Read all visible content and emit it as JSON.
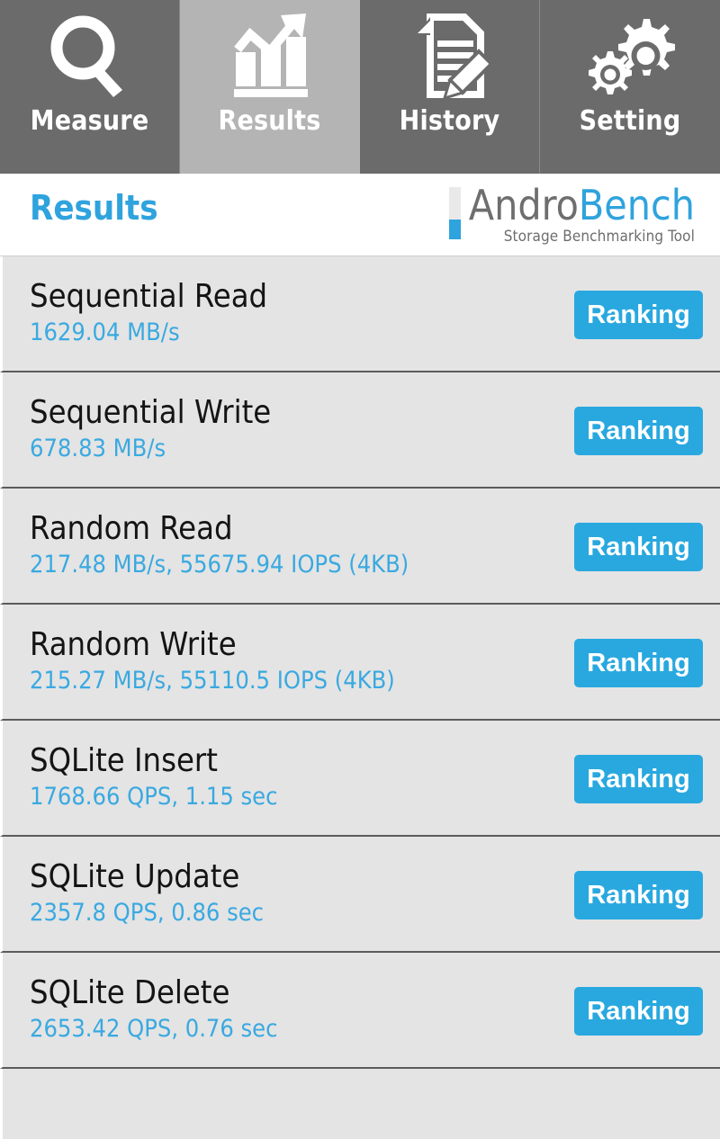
{
  "tabs": [
    {
      "label": "Measure",
      "icon": "magnifier-icon",
      "active": false
    },
    {
      "label": "Results",
      "icon": "bar-chart-trend-icon",
      "active": true
    },
    {
      "label": "History",
      "icon": "document-pencil-icon",
      "active": false
    },
    {
      "label": "Setting",
      "icon": "gears-icon",
      "active": false
    }
  ],
  "header": {
    "title": "Results",
    "logo": {
      "name_part1": "Andro",
      "name_part2": "Bench",
      "tagline": "Storage Benchmarking Tool"
    }
  },
  "results": {
    "button_label": "Ranking",
    "rows": [
      {
        "title": "Sequential Read",
        "value": "1629.04 MB/s"
      },
      {
        "title": "Sequential Write",
        "value": "678.83 MB/s"
      },
      {
        "title": "Random Read",
        "value": "217.48 MB/s, 55675.94 IOPS (4KB)"
      },
      {
        "title": "Random Write",
        "value": "215.27 MB/s, 55110.5 IOPS (4KB)"
      },
      {
        "title": "SQLite Insert",
        "value": "1768.66 QPS, 1.15 sec"
      },
      {
        "title": "SQLite Update",
        "value": "2357.8 QPS, 0.86 sec"
      },
      {
        "title": "SQLite Delete",
        "value": "2653.42 QPS, 0.76 sec"
      }
    ]
  },
  "colors": {
    "accent_blue": "#29a8df",
    "value_blue": "#3aa9e0",
    "tab_inactive": "#6b6b6b",
    "tab_active": "#b4b4b4",
    "row_background": "#e4e4e4",
    "logo_gray": "#6e6e6e"
  }
}
